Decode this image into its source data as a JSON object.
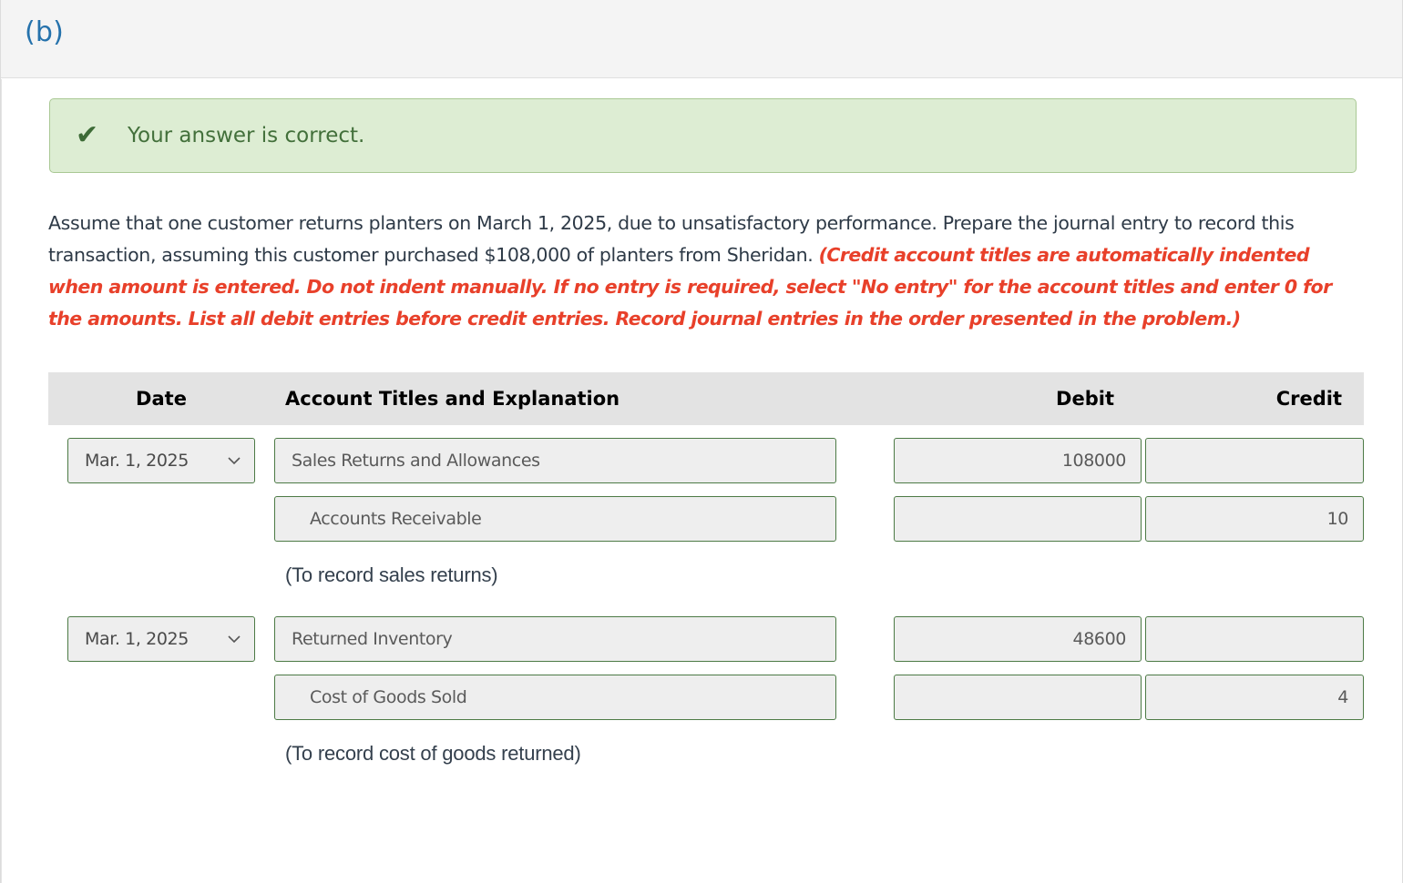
{
  "header": {
    "part_label": "(b)",
    "accent_color": "#2572ac"
  },
  "banner": {
    "icon": "check-icon",
    "message": "Your answer is correct.",
    "bg_color": "#ddedd3",
    "border_color": "#a9c894",
    "text_color": "#43703b"
  },
  "question": {
    "body": "Assume that one customer returns planters on March 1, 2025, due to unsatisfactory performance. Prepare the journal entry to record this transaction, assuming this customer purchased $108,000 of planters from Sheridan. ",
    "instruction": "(Credit account titles are automatically indented when amount is entered. Do not indent manually. If no entry is required, select \"No entry\" for the account titles and enter 0 for the amounts. List all debit entries before credit entries. Record journal entries in the order presented in the problem.)",
    "instruction_color": "#e8402a"
  },
  "table": {
    "columns": [
      "Date",
      "Account Titles and Explanation",
      "Debit",
      "Credit"
    ],
    "header_bg": "#e3e3e3",
    "field_bg": "#eeeeee",
    "field_border": "#4c7a45",
    "rows": [
      {
        "type": "entry",
        "date": "Mar. 1, 2025",
        "account": "Sales Returns and Allowances",
        "indented": false,
        "debit": "108000",
        "credit": ""
      },
      {
        "type": "entry",
        "date": "",
        "account": "Accounts Receivable",
        "indented": true,
        "debit": "",
        "credit": "10"
      },
      {
        "type": "explanation",
        "text": "(To record sales returns)"
      },
      {
        "type": "entry",
        "date": "Mar. 1, 2025",
        "account": "Returned Inventory",
        "indented": false,
        "debit": "48600",
        "credit": ""
      },
      {
        "type": "entry",
        "date": "",
        "account": "Cost of Goods Sold",
        "indented": true,
        "debit": "",
        "credit": "4"
      },
      {
        "type": "explanation",
        "text": "(To record cost of goods returned)"
      }
    ]
  }
}
